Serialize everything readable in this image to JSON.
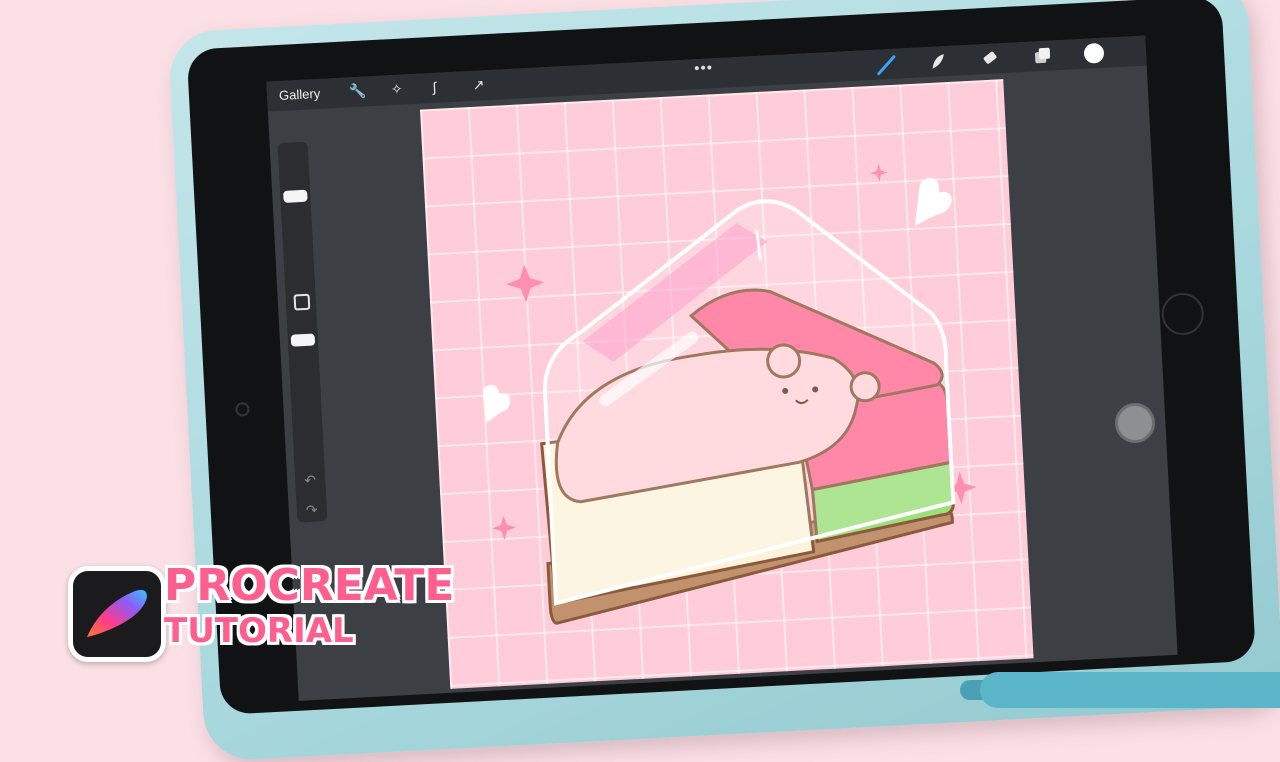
{
  "app": {
    "name": "Procreate",
    "gallery_label": "Gallery",
    "more_menu": "•••"
  },
  "toolbar": {
    "left_tools": [
      "wrench-icon",
      "magic-wand-icon",
      "selection-icon",
      "transform-icon"
    ],
    "right_tools": [
      "brush-icon",
      "smudge-icon",
      "eraser-icon",
      "layers-icon",
      "color-icon"
    ],
    "active_tool": "brush-icon",
    "accent_color": "#3aa2ff",
    "current_color": "#ffffff"
  },
  "sidebar": {
    "size_level": 0.9,
    "opacity_level": 0.6,
    "buttons": [
      "modify-button",
      "undo-button",
      "redo-button"
    ]
  },
  "canvas": {
    "artwork": "bear-on-cake-slice",
    "background_color": "#ffcdd9",
    "grid": true
  },
  "overlay": {
    "title_line1": "PROCREATE",
    "title_line2": "TUTORIAL",
    "title_color": "#ff5f8f"
  }
}
